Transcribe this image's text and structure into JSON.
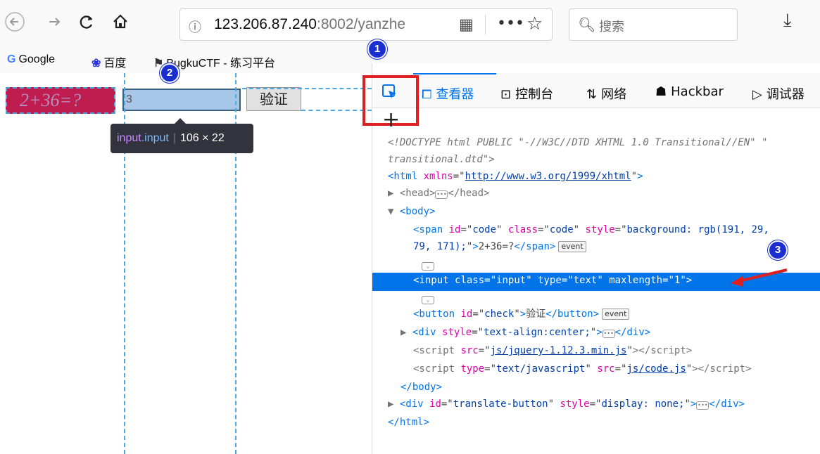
{
  "toolbar": {
    "back_icon": "back-arrow-icon",
    "forward_icon": "forward-arrow-icon",
    "reload_icon": "reload-icon",
    "home_icon": "home-icon",
    "url_host": "123.206.87.240",
    "url_rest": ":8002/yanzhe",
    "search_placeholder": "搜索"
  },
  "bookmarks": [
    {
      "icon": "G",
      "label": "Google"
    },
    {
      "icon": "❀",
      "label": "百度"
    },
    {
      "icon": "⚑",
      "label": "BugkuCTF - 练习平台"
    }
  ],
  "page": {
    "code_text": "2+36=?",
    "code_bg": "#bf1d4f",
    "input_value": "3",
    "verify_label": "验证",
    "tooltip_tag": "input",
    "tooltip_class": ".input",
    "tooltip_size": "106 × 22"
  },
  "devtools": {
    "tabs": [
      {
        "label": "查看器"
      },
      {
        "label": "控制台"
      },
      {
        "label": "网络"
      },
      {
        "label": "Hackbar"
      },
      {
        "label": "调试器"
      }
    ],
    "markup": {
      "doctype_1": "<!DOCTYPE html PUBLIC \"-//W3C//DTD XHTML 1.0 Transitional//EN\" \"",
      "doctype_2": "transitional.dtd\">",
      "html_xmlns": "http://www.w3.org/1999/xhtml",
      "span_style_1": "background: rgb(191, 29,",
      "span_style_2": "79, 171);",
      "span_text": "2+36=?",
      "input_class": "input",
      "input_type": "text",
      "input_maxlength": "1",
      "button_id": "check",
      "button_text": "验证",
      "div_style": "text-align:center;",
      "script1_src": "js/jquery-1.12.3.min.js",
      "script2_type": "text/javascript",
      "script2_src": "js/code.js",
      "translate_id": "translate-button",
      "translate_style": "display: none;",
      "event_badge": "event"
    }
  },
  "markers": [
    "1",
    "2",
    "3"
  ],
  "highlight_color": "#e02020",
  "marker_color": "#1b2fd1"
}
